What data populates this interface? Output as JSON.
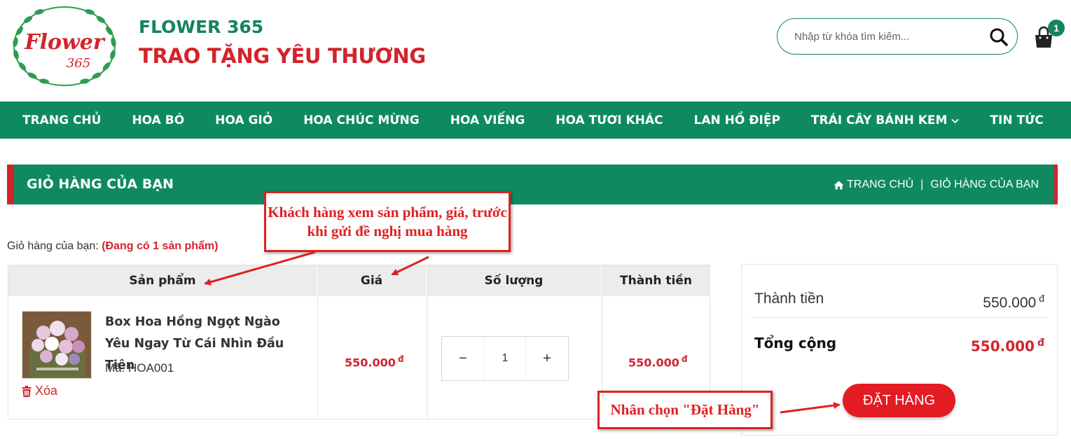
{
  "header": {
    "logo_text": "Flower 365",
    "brand_line1": "FLOWER 365",
    "brand_line2": "TRAO TẶNG YÊU THƯƠNG",
    "search_placeholder": "Nhập từ khóa tìm kiếm...",
    "search_icon": "search-icon",
    "cart_icon": "shopping-bag-icon",
    "cart_count": "1"
  },
  "nav": {
    "items": [
      {
        "label": "TRANG CHỦ"
      },
      {
        "label": "HOA BÓ"
      },
      {
        "label": "HOA GIỎ"
      },
      {
        "label": "HOA CHÚC MỪNG"
      },
      {
        "label": "HOA VIẾNG"
      },
      {
        "label": "HOA TƯƠI KHÁC"
      },
      {
        "label": "LAN HỒ ĐIỆP"
      },
      {
        "label": "TRÁI CÂY BÁNH KEM",
        "has_dropdown": true
      },
      {
        "label": "TIN TỨC"
      }
    ]
  },
  "page": {
    "title": "GIỎ HÀNG CỦA BẠN",
    "breadcrumb": {
      "home": "TRANG CHỦ",
      "current": "GIỎ HÀNG CỦA BẠN"
    },
    "cart_prefix": "Giỏ hàng của bạn:",
    "cart_status": "(Đang có 1 sản phẩm)"
  },
  "table": {
    "headers": {
      "product": "Sản phẩm",
      "price": "Giá",
      "quantity": "Số lượng",
      "total": "Thành tiền"
    },
    "rows": [
      {
        "name": "Box Hoa Hồng Ngọt Ngào Yêu Ngay Từ Cái Nhìn Đầu Tiên",
        "code": "Mã: HOA001",
        "price": "550.000",
        "currency": "đ",
        "quantity": "1",
        "total": "550.000",
        "remove_label": "Xóa",
        "minus": "−",
        "plus": "+"
      }
    ]
  },
  "summary": {
    "subtotal_label": "Thành tiền",
    "subtotal_value": "550.000",
    "total_label": "Tổng cộng",
    "total_value": "550.000",
    "currency": "đ",
    "order_button": "ĐẶT HÀNG"
  },
  "annotations": {
    "note1": "Khách hàng xem sản phẩm, giá, trước khi gửi đề nghị mua hàng",
    "note2": "Nhân chọn \"Đặt Hàng\""
  },
  "colors": {
    "brand_green": "#0f8a5f",
    "brand_red": "#d3232c",
    "button_red": "#e31b23",
    "annotation_red": "#e02020"
  }
}
